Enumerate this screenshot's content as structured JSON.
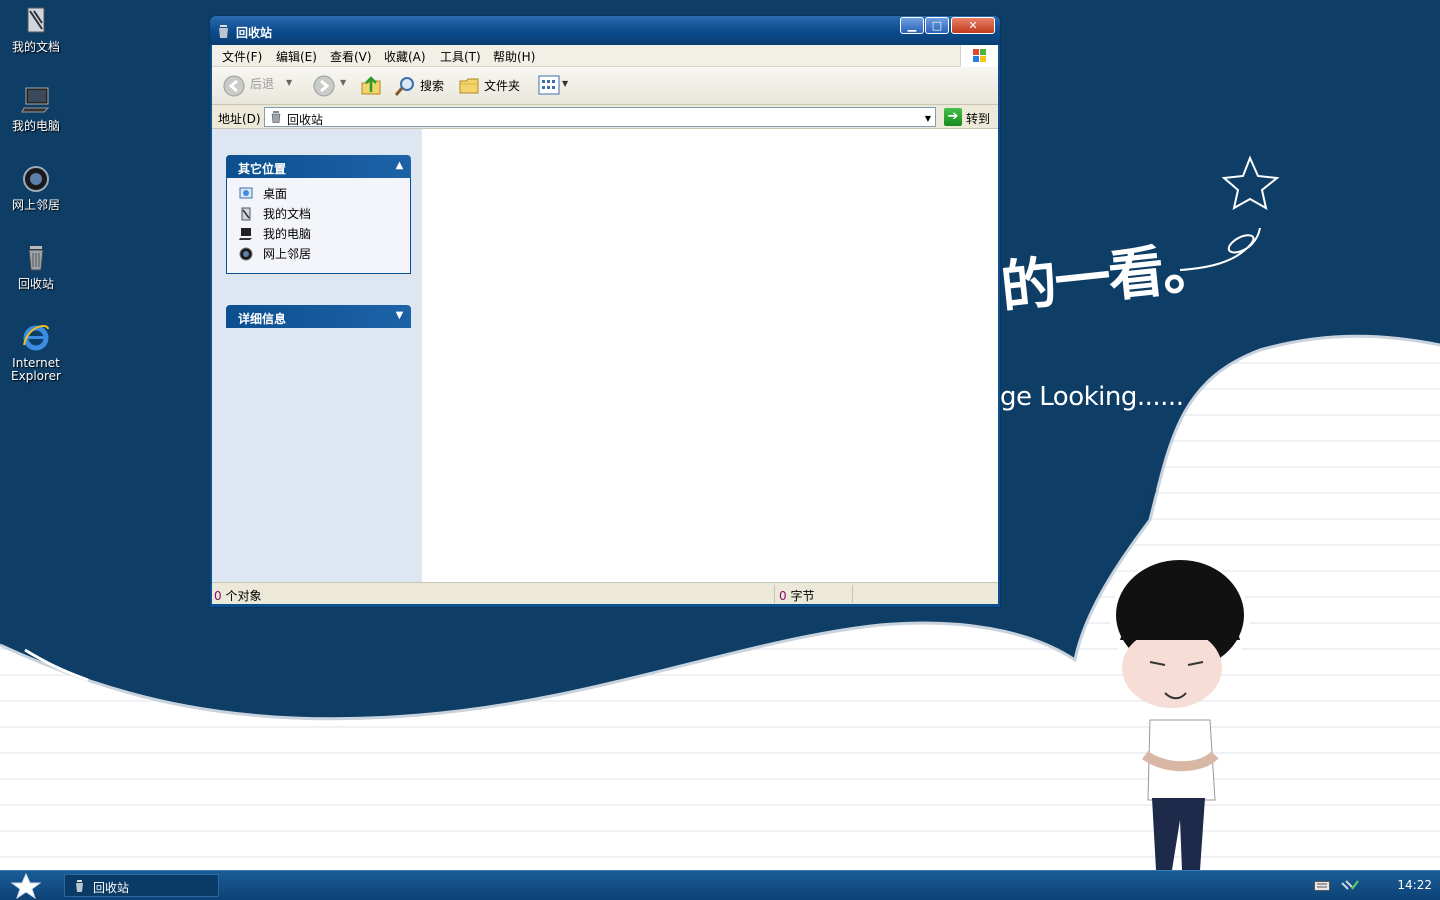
{
  "desktop": {
    "icons": [
      {
        "label": "我的文档",
        "icon": "my-documents-icon"
      },
      {
        "label": "我的电脑",
        "icon": "my-computer-icon"
      },
      {
        "label": "网上邻居",
        "icon": "network-places-icon"
      },
      {
        "label": "回收站",
        "icon": "recycle-bin-icon"
      },
      {
        "label": "Internet Explorer",
        "icon": "internet-explorer-icon"
      }
    ],
    "wallpaper_text_cn": "的一看。",
    "wallpaper_text_en": "ge Looking......"
  },
  "window": {
    "title": "回收站",
    "menu": [
      "文件(F)",
      "编辑(E)",
      "查看(V)",
      "收藏(A)",
      "工具(T)",
      "帮助(H)"
    ],
    "toolbar": {
      "back": "后退",
      "search": "搜索",
      "folders": "文件夹"
    },
    "address": {
      "label": "地址(D)",
      "value": "回收站",
      "go": "转到"
    },
    "sidebar": {
      "other_places": {
        "title": "其它位置",
        "items": [
          "桌面",
          "我的文档",
          "我的电脑",
          "网上邻居"
        ]
      },
      "details": {
        "title": "详细信息"
      }
    },
    "status": {
      "objects_count": "0",
      "objects_label": "个对象",
      "bytes_count": "0",
      "bytes_label": "字节"
    }
  },
  "taskbar": {
    "task_label": "回收站",
    "clock": "14:22"
  },
  "colors": {
    "wallpaper_blue": "#0e3d66",
    "window_frame": "#0b4f8f",
    "taskbar": "#0d4275"
  }
}
